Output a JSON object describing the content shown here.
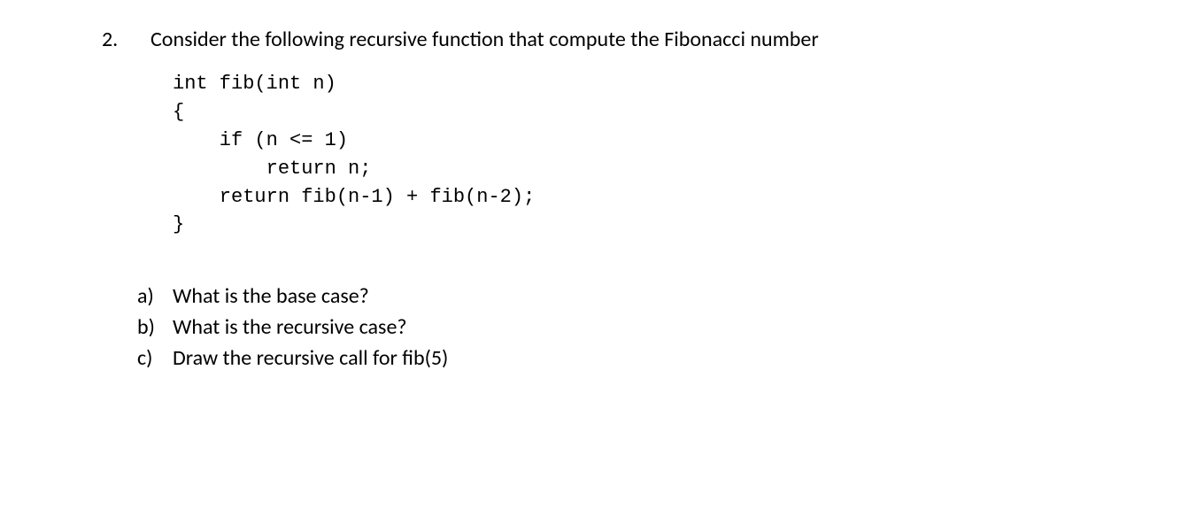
{
  "question": {
    "number": "2.",
    "text": "Consider the following recursive function that compute the Fibonacci number"
  },
  "code": {
    "line1": "int fib(int n)",
    "line2": "{",
    "line3": "    if (n <= 1)",
    "line4": "        return n;",
    "line5": "    return fib(n-1) + fib(n-2);",
    "line6": "}"
  },
  "subquestions": [
    {
      "letter": "a)",
      "text": "What is the base case?"
    },
    {
      "letter": "b)",
      "text": "What is the recursive case?"
    },
    {
      "letter": "c)",
      "text": "Draw the recursive call for  fib(5)"
    }
  ]
}
